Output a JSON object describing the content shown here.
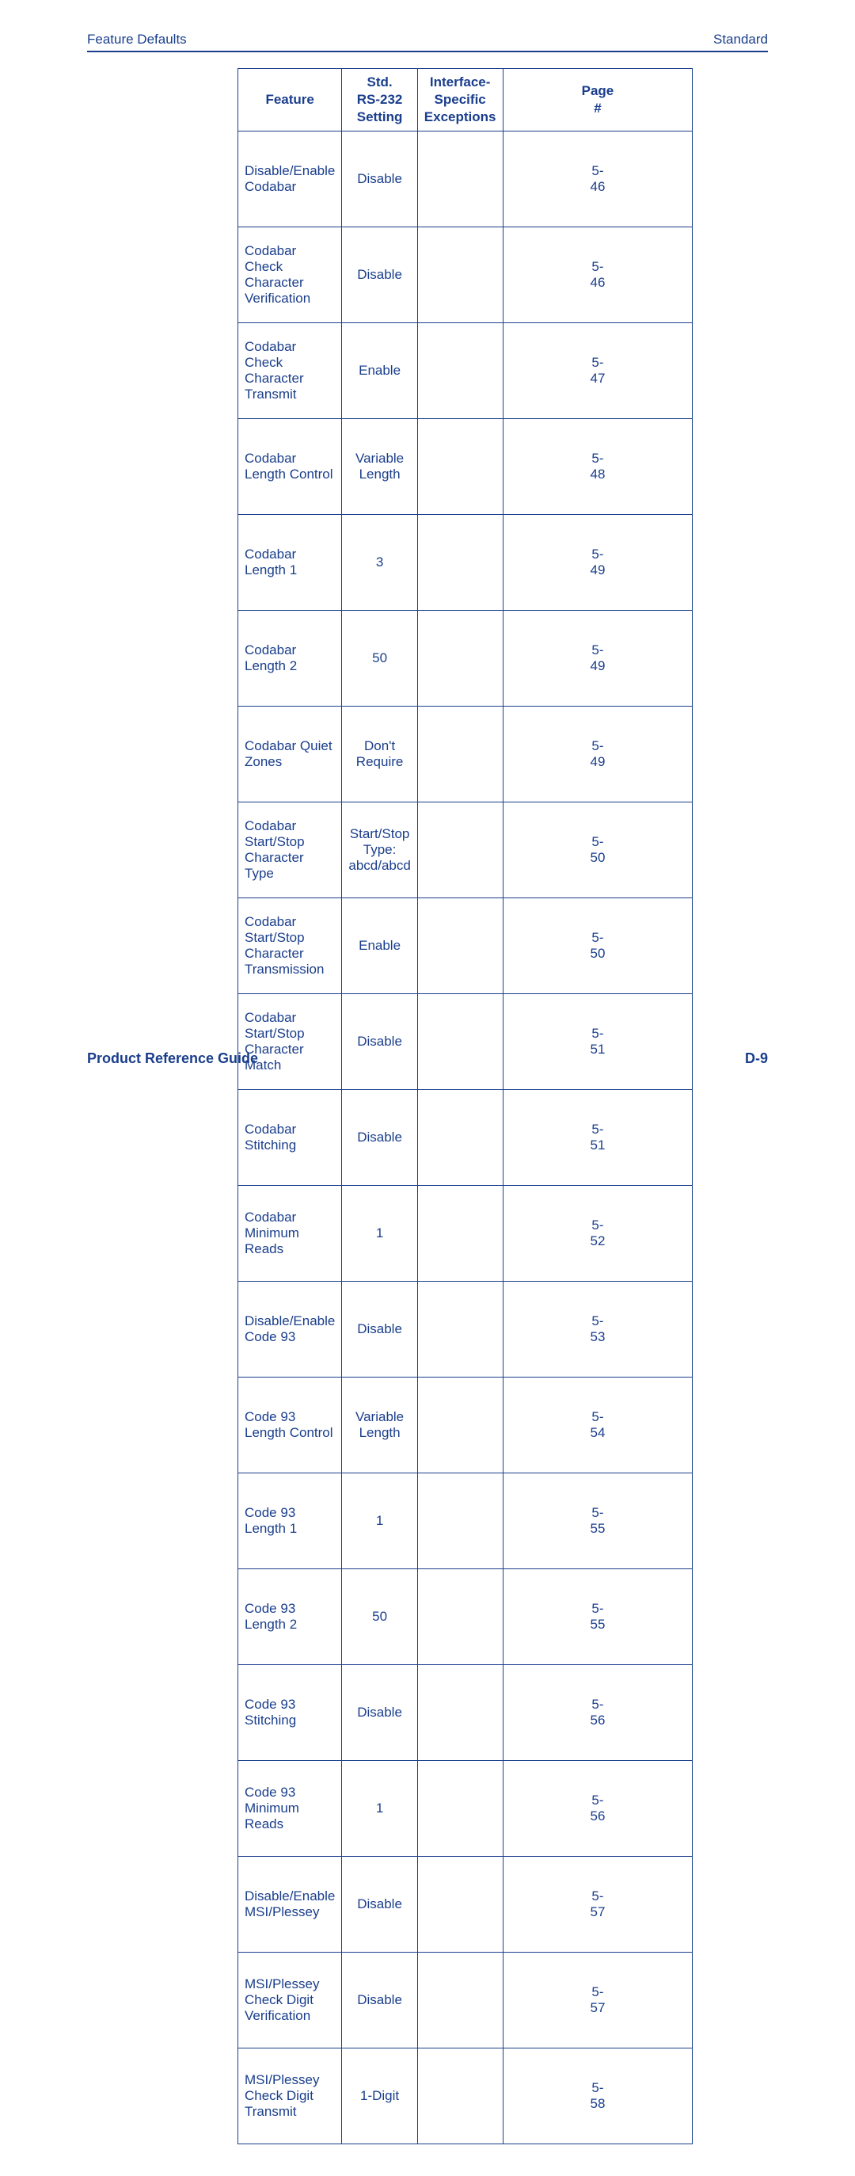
{
  "header": {
    "left": "Feature Defaults",
    "right": "Standard"
  },
  "columns": {
    "feature": "Feature",
    "setting": "Std. RS-232 Setting",
    "exceptions": "Interface-Specific Exceptions",
    "page": "Page #"
  },
  "rows": [
    {
      "feature": "Disable/Enable Codabar",
      "setting": "Disable",
      "exceptions": "",
      "page": "5-46"
    },
    {
      "feature": "Codabar Check Character Verification",
      "setting": "Disable",
      "exceptions": "",
      "page": "5-46"
    },
    {
      "feature": "Codabar Check Character Transmit",
      "setting": "Enable",
      "exceptions": "",
      "page": "5-47"
    },
    {
      "feature": "Codabar Length Control",
      "setting": "Variable Length",
      "exceptions": "",
      "page": "5-48"
    },
    {
      "feature": "Codabar Length 1",
      "setting": "3",
      "exceptions": "",
      "page": "5-49"
    },
    {
      "feature": "Codabar Length 2",
      "setting": "50",
      "exceptions": "",
      "page": "5-49"
    },
    {
      "feature": "Codabar Quiet Zones",
      "setting": "Don't Require",
      "exceptions": "",
      "page": "5-49"
    },
    {
      "feature": "Codabar Start/Stop Character Type",
      "setting": "Start/Stop Type: abcd/abcd",
      "exceptions": "",
      "page": "5-50"
    },
    {
      "feature": "Codabar Start/Stop Character Transmission",
      "setting": "Enable",
      "exceptions": "",
      "page": "5-50"
    },
    {
      "feature": "Codabar Start/Stop Character Match",
      "setting": "Disable",
      "exceptions": "",
      "page": "5-51"
    },
    {
      "feature": "Codabar Stitching",
      "setting": "Disable",
      "exceptions": "",
      "page": "5-51"
    },
    {
      "feature": "Codabar Minimum Reads",
      "setting": "1",
      "exceptions": "",
      "page": "5-52"
    },
    {
      "feature": "Disable/Enable Code 93",
      "setting": "Disable",
      "exceptions": "",
      "page": "5-53"
    },
    {
      "feature": "Code 93 Length Control",
      "setting": "Variable Length",
      "exceptions": "",
      "page": "5-54"
    },
    {
      "feature": "Code 93 Length 1",
      "setting": "1",
      "exceptions": "",
      "page": "5-55"
    },
    {
      "feature": "Code 93 Length 2",
      "setting": "50",
      "exceptions": "",
      "page": "5-55"
    },
    {
      "feature": "Code 93 Stitching",
      "setting": "Disable",
      "exceptions": "",
      "page": "5-56"
    },
    {
      "feature": "Code 93 Minimum Reads",
      "setting": "1",
      "exceptions": "",
      "page": "5-56"
    },
    {
      "feature": "Disable/Enable MSI/Plessey",
      "setting": "Disable",
      "exceptions": "",
      "page": "5-57"
    },
    {
      "feature": "MSI/Plessey Check Digit Verification",
      "setting": "Disable",
      "exceptions": "",
      "page": "5-57"
    },
    {
      "feature": "MSI/Plessey Check Digit Transmit",
      "setting": "1-Digit",
      "exceptions": "",
      "page": "5-58"
    }
  ],
  "footer": {
    "left": "Product Reference Guide",
    "right": "D-9"
  }
}
